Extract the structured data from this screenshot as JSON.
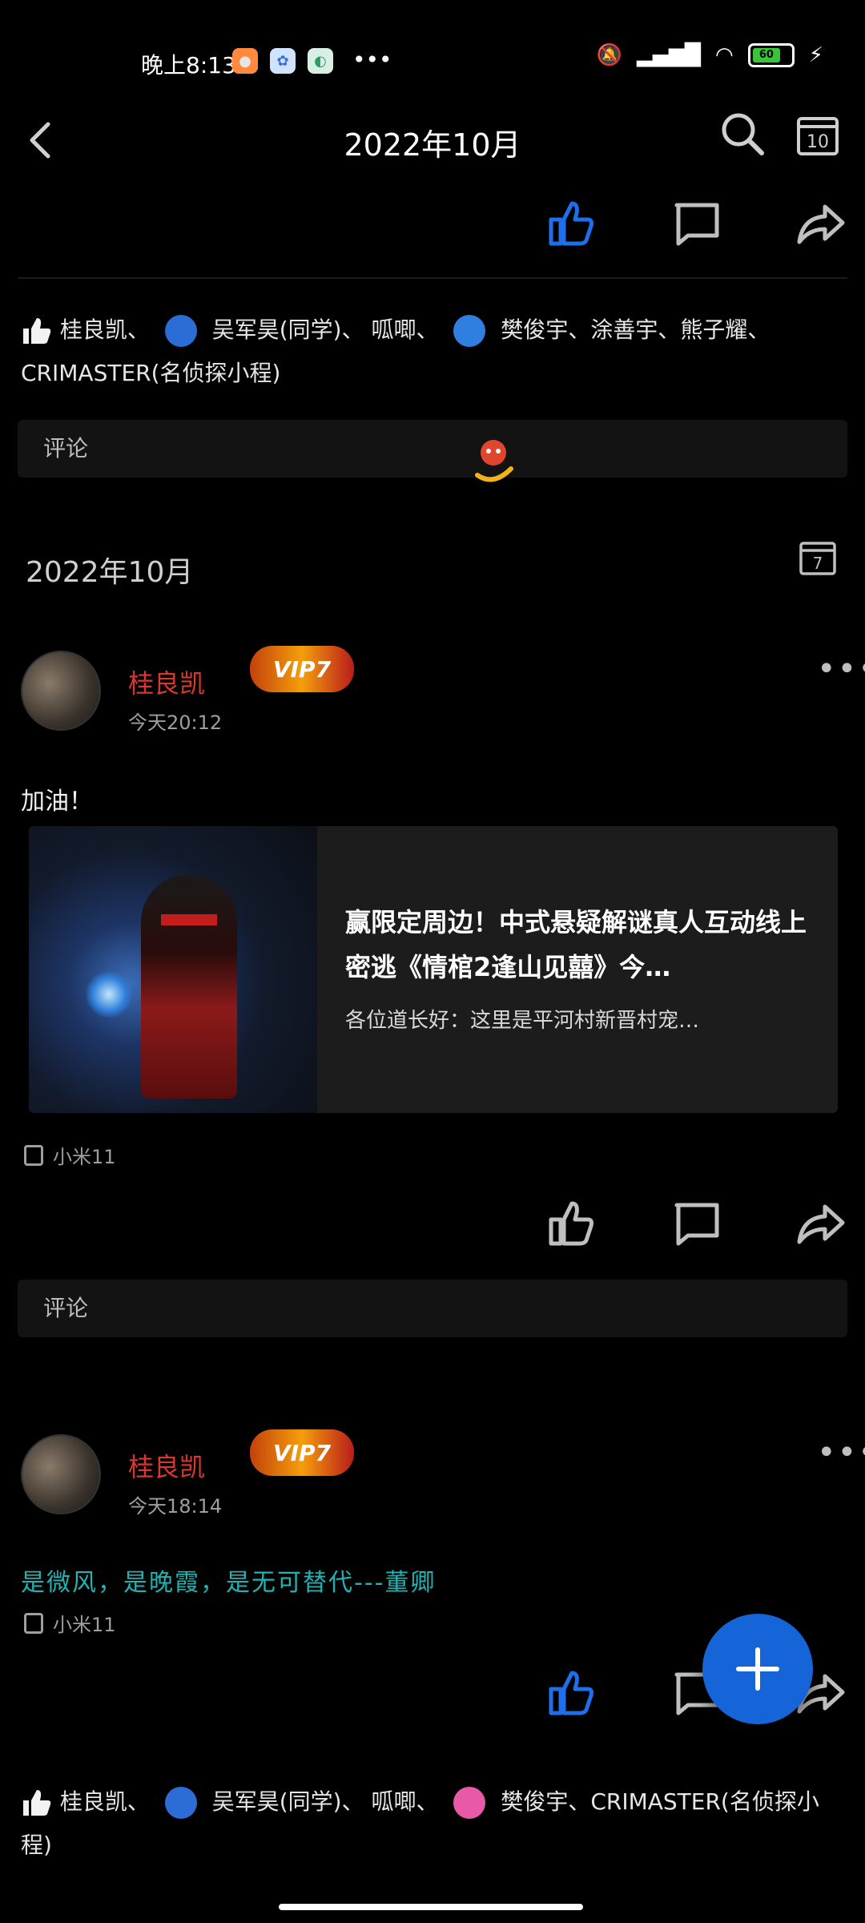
{
  "status_bar": {
    "time": "晚上8:13",
    "more": "•••",
    "battery": "60"
  },
  "header": {
    "title": "2022年10月"
  },
  "feed": {
    "first_post": {
      "likes_prefix": "桂良凯、",
      "likers": [
        "吴军昊(同学)、",
        "呱唧、",
        "樊俊宇、涂善宇、熊子耀、CRIMASTER(名侦探小程)"
      ],
      "comment_placeholder": "评论"
    },
    "month_heading": "2022年10月",
    "post_a": {
      "author": "桂良凯",
      "vip_label": "VIP7",
      "time": "今天20:12",
      "text": "加油！",
      "card_title": "赢限定周边！中式悬疑解谜真人互动线上密逃《情棺2逢山见囍》今…",
      "card_sub": "各位道长好：这里是平河村新晋村宠…",
      "device": "小米11",
      "comment_placeholder": "评论"
    },
    "post_b": {
      "author": "桂良凯",
      "vip_label": "VIP7",
      "time": "今天18:14",
      "text": "是微风，是晚霞，是无可替代---董卿",
      "device": "小米11",
      "likes_prefix": "桂良凯、",
      "likers": [
        "吴军昊(同学)、",
        "呱唧、",
        "樊俊宇、CRIMASTER(名侦探小程)"
      ]
    }
  },
  "colors": {
    "accent": "#1565d8",
    "name_red": "#d8382f",
    "quote_teal": "#1fb3b3",
    "liked_blue": "#1f6feb"
  }
}
